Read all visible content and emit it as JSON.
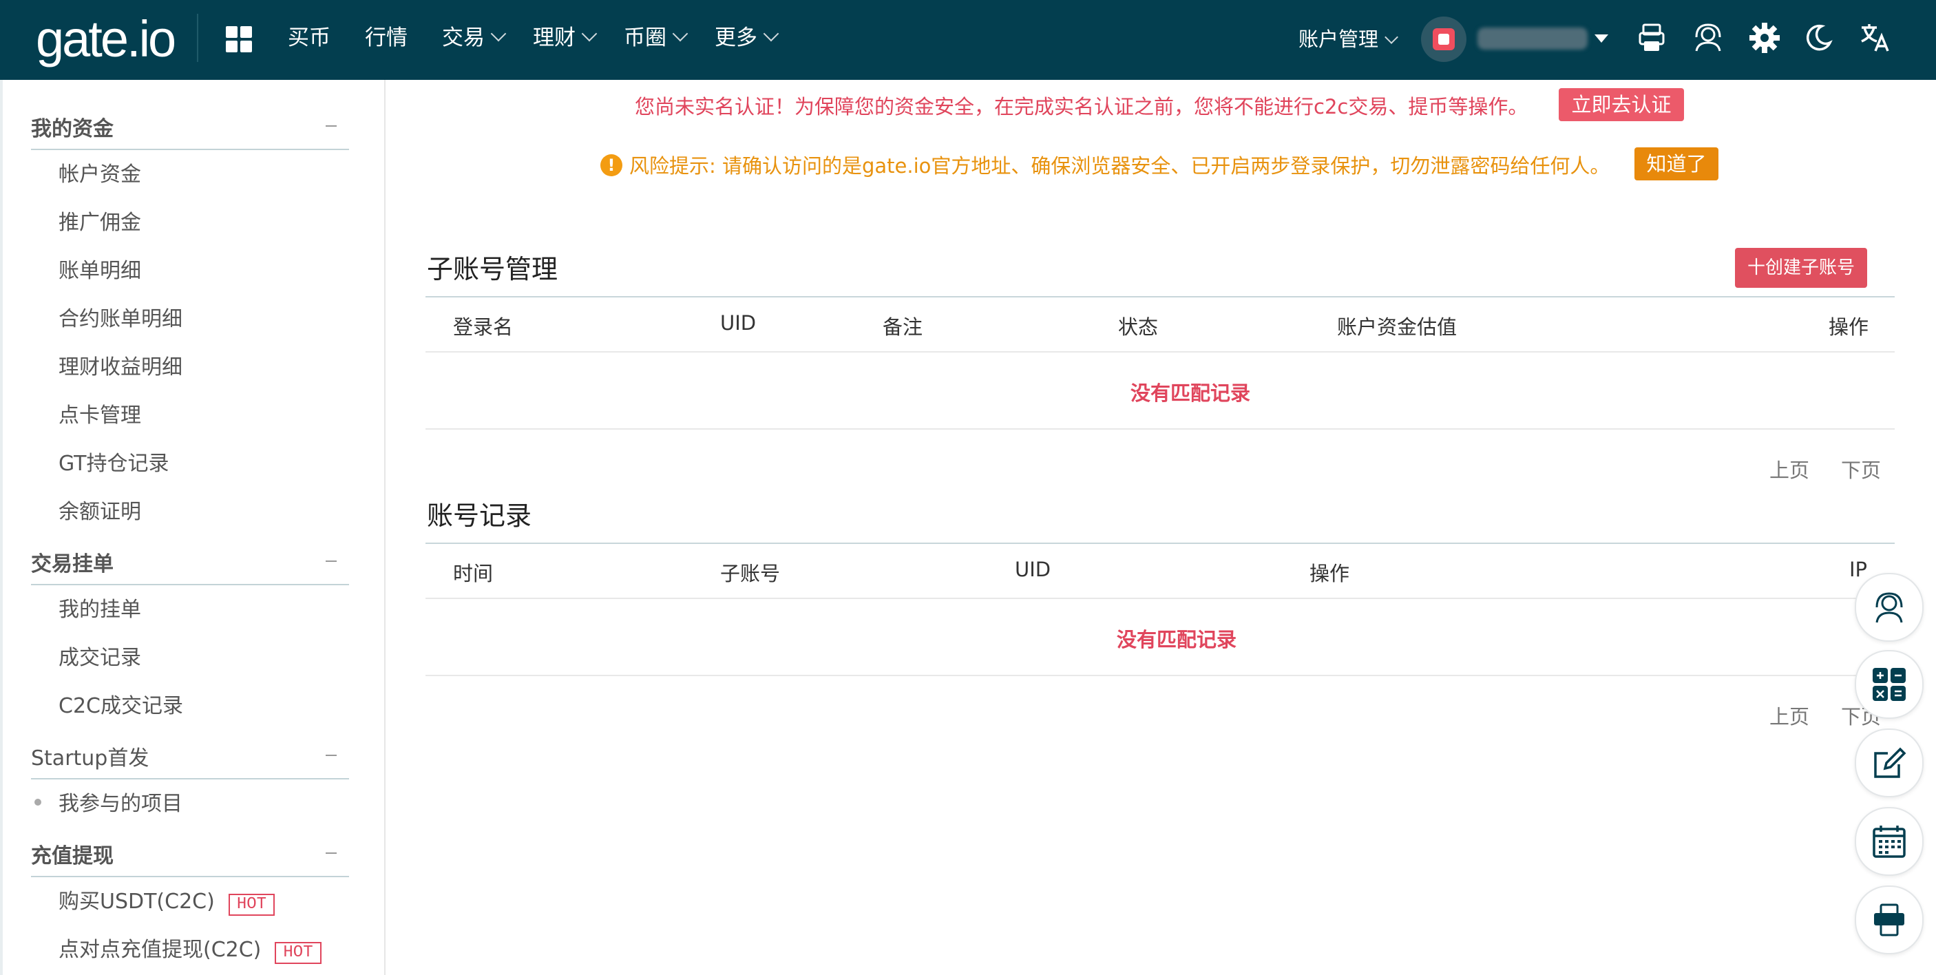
{
  "header": {
    "logo": "gate.io",
    "nav": [
      {
        "label": "买币",
        "has_menu": false
      },
      {
        "label": "行情",
        "has_menu": false
      },
      {
        "label": "交易",
        "has_menu": true
      },
      {
        "label": "理财",
        "has_menu": true
      },
      {
        "label": "币圈",
        "has_menu": true
      },
      {
        "label": "更多",
        "has_menu": true
      }
    ],
    "account_menu": "账户管理",
    "icons": [
      "apps-icon",
      "app-download-icon",
      "support-icon",
      "settings-icon",
      "dark-mode-icon",
      "language-icon"
    ]
  },
  "sidebar": {
    "sections": [
      {
        "title": "我的资金",
        "items": [
          "帐户资金",
          "推广佣金",
          "账单明细",
          "合约账单明细",
          "理财收益明细",
          "点卡管理",
          "GT持仓记录",
          "余额证明"
        ]
      },
      {
        "title": "交易挂单",
        "items": [
          "我的挂单",
          "成交记录",
          "C2C成交记录"
        ]
      },
      {
        "title": "Startup首发",
        "items": [
          "我参与的项目"
        ]
      },
      {
        "title": "充值提现",
        "items": [
          "购买USDT(C2C)",
          "点对点充值提现(C2C)"
        ]
      }
    ],
    "hot_badge": "HOT"
  },
  "notices": {
    "kyc_text": "您尚未实名认证！为保障您的资金安全，在完成实名认证之前，您将不能进行c2c交易、提币等操作。",
    "kyc_button": "立即去认证",
    "risk_text": "风险提示: 请确认访问的是gate.io官方地址、确保浏览器安全、已开启两步登录保护，切勿泄露密码给任何人。",
    "risk_button": "知道了"
  },
  "subaccounts": {
    "title": "子账号管理",
    "create_button": "十创建子账号",
    "columns": [
      "登录名",
      "UID",
      "备注",
      "状态",
      "账户资金估值",
      "操作"
    ],
    "empty_text": "没有匹配记录",
    "prev": "上页",
    "next": "下页"
  },
  "records": {
    "title": "账号记录",
    "columns": [
      "时间",
      "子账号",
      "UID",
      "操作",
      "IP"
    ],
    "empty_text": "没有匹配记录",
    "prev": "上页",
    "next": "下页"
  },
  "floating_tools": [
    "customer-service-icon",
    "calculator-icon",
    "edit-icon",
    "calendar-icon",
    "app-icon"
  ],
  "colors": {
    "header_bg": "#033e4f",
    "alert_red": "#e0455c",
    "warning_orange": "#e8890b"
  }
}
